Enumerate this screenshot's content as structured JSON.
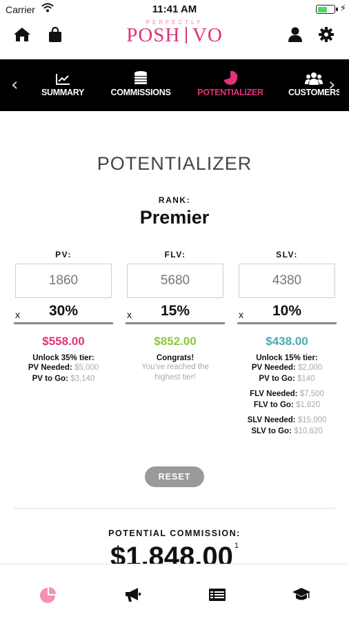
{
  "status_bar": {
    "carrier": "Carrier",
    "time": "11:41 AM",
    "battery_level": 0.6
  },
  "header": {
    "logo_small": "PERFECTLY",
    "logo_main": "POSH",
    "logo_suffix": "VO",
    "icons": [
      "home-icon",
      "shopping-bag-icon",
      "user-icon",
      "gear-icon"
    ]
  },
  "tabs": [
    {
      "label": "SUMMARY",
      "icon": "line-chart-icon",
      "active": false
    },
    {
      "label": "COMMISSIONS",
      "icon": "coins-icon",
      "active": false
    },
    {
      "label": "POTENTIALIZER",
      "icon": "pie-chart-icon",
      "active": true
    },
    {
      "label": "CUSTOMERS",
      "icon": "users-icon",
      "active": false
    }
  ],
  "main": {
    "title": "POTENTIALIZER",
    "rank_label": "RANK:",
    "rank": "Premier",
    "columns": {
      "pv": {
        "label": "PV:",
        "input": "1860",
        "multiplier_prefix": "x",
        "percent": "30%",
        "amount": "$558.00",
        "amount_color": "#e2327a",
        "message": "Unlock 35% tier:",
        "needed_label": "PV Needed:",
        "needed_value": "$5,000",
        "to_go_label": "PV to Go:",
        "to_go_value": "$3,140"
      },
      "flv": {
        "label": "FLV:",
        "input": "5680",
        "multiplier_prefix": "x",
        "percent": "15%",
        "amount": "$852.00",
        "amount_color": "#8dc63f",
        "message": "Congrats!",
        "sub_message_1": "You've reached the",
        "sub_message_2": "highest tier!"
      },
      "slv": {
        "label": "SLV:",
        "input": "4380",
        "multiplier_prefix": "x",
        "percent": "10%",
        "amount": "$438.00",
        "amount_color": "#4aaab5",
        "message": "Unlock 15% tier:",
        "pv_needed_label": "PV Needed:",
        "pv_needed_value": "$2,000",
        "pv_to_go_label": "PV to Go:",
        "pv_to_go_value": "$140",
        "flv_needed_label": "FLV Needed:",
        "flv_needed_value": "$7,500",
        "flv_to_go_label": "FLV to Go:",
        "flv_to_go_value": "$1,820",
        "slv_needed_label": "SLV Needed:",
        "slv_needed_value": "$15,000",
        "slv_to_go_label": "SLV to Go:",
        "slv_to_go_value": "$10,620"
      }
    },
    "reset_label": "RESET",
    "potential_label": "POTENTIAL COMMISSION:",
    "potential_value": "$1,848.00",
    "potential_footnote": "1"
  },
  "bottom_nav": [
    "pie-chart-icon",
    "megaphone-icon",
    "list-icon",
    "graduation-cap-icon"
  ],
  "colors": {
    "brand_pink": "#e2327a",
    "tab_bar_bg": "#000000"
  }
}
